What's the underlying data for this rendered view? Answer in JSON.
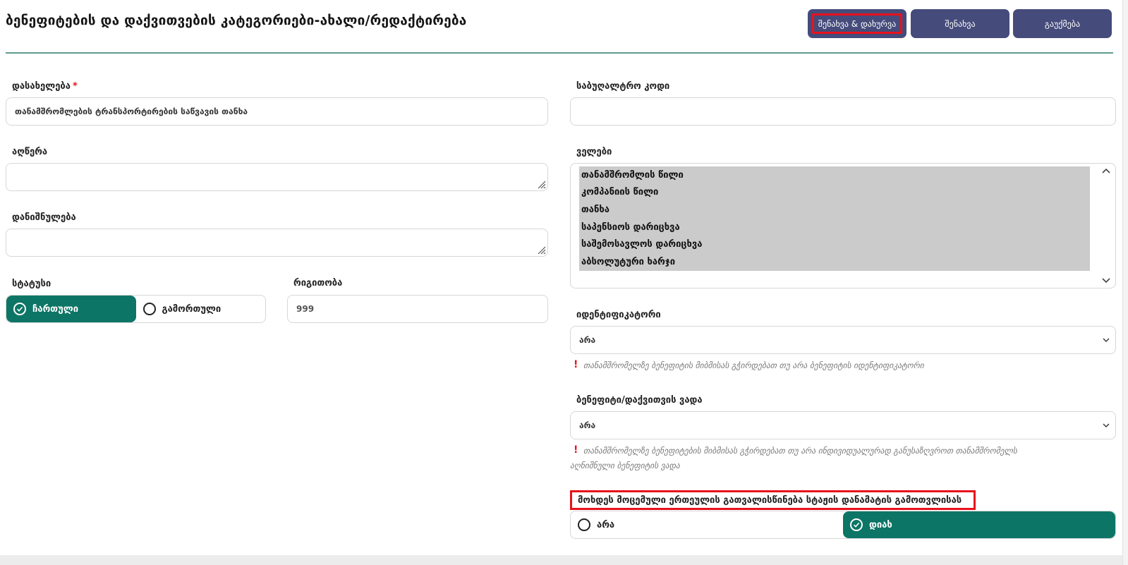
{
  "header": {
    "title": "ბენეფიტების და დაქვითვების კატეგორიები-ახალი/რედაქტირება",
    "buttons": {
      "save_close": "შენახვა & დახურვა",
      "save": "შენახვა",
      "cancel": "გაუქმება"
    }
  },
  "form_left": {
    "name": {
      "label": "დასახელება",
      "required_mark": "*",
      "value": "თანამშრომლების ტრანსპორტირების საწვავის თანხა"
    },
    "description": {
      "label": "აღწერა",
      "value": ""
    },
    "purpose": {
      "label": "დანიშნულება",
      "value": ""
    },
    "status": {
      "label": "სტატუსი",
      "options": [
        "ჩართული",
        "გამორთული"
      ],
      "selected": "ჩართული"
    },
    "order": {
      "label": "რიგითობა",
      "value": "999"
    }
  },
  "form_right": {
    "accounting_code": {
      "label": "საბუღალტრო კოდი",
      "value": ""
    },
    "fields": {
      "label": "ველები",
      "items": [
        "თანამშრომლის წილი",
        "კომპანიის წილი",
        "თანხა",
        "საპენსიოს დარიცხვა",
        "საშემოსავლოს დარიცხვა",
        "აბსოლუტური ხარჯი"
      ]
    },
    "identifier": {
      "label": "იდენტიფიკატორი",
      "value": "არა",
      "hint_mark": "!",
      "hint": "თანამშრომელზე ბენეფიტის მიბმისას გჭირდებათ თუ არა ბენეფიტის იდენტიფიკატორი"
    },
    "term": {
      "label": "ბენეფიტი/დაქვითვის ვადა",
      "value": "არა",
      "hint_mark": "!",
      "hint_line1": "თანამშრომელზე ბენეფიტების მიბმისას გჭირდებათ თუ არა ინდივიდუალურად განუსაზღვროთ თანამშრომელს",
      "hint_line2": "აღნიშნული ბენეფიტის ვადა"
    },
    "unit_consideration": {
      "label": "მოხდეს მოცემული ერთეულის გათვალისწინება სტაჟის დანამატის გამოთვლისას",
      "options": [
        "არა",
        "დიახ"
      ],
      "selected": "დიახ"
    }
  },
  "colors": {
    "primary_button": "#454b7a",
    "active_toggle": "#0d7566",
    "highlight": "#e8121b",
    "rule": "#5e9c8f"
  }
}
